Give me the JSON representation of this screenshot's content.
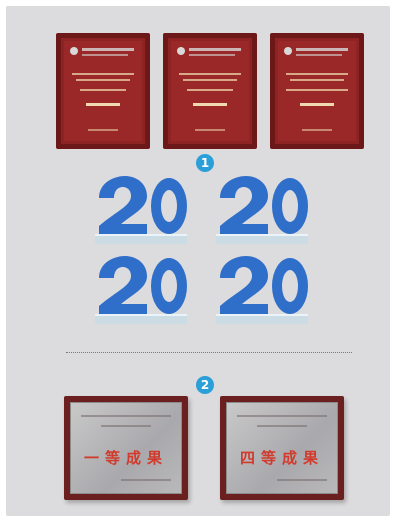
{
  "badges": {
    "first": "1",
    "second": "2"
  },
  "certificates": [
    {
      "title": "一等成果"
    },
    {
      "title": "四等成果"
    }
  ],
  "colors": {
    "panel": "#dcdcde",
    "badge": "#2b9fd8",
    "trophy_blue": "#2f6fc9",
    "plaque_wood": "#7a1f1f",
    "cert_frame": "#6b1f1f",
    "cert_title": "#d23a2c"
  }
}
